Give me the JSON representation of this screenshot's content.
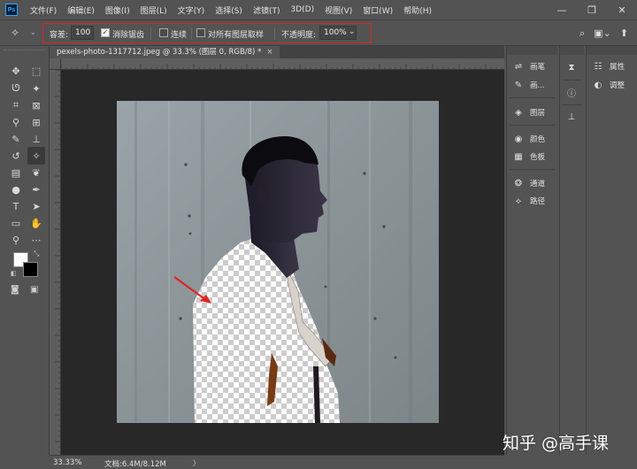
{
  "menubar": {
    "logo": "Ps",
    "items": [
      "文件(F)",
      "编辑(E)",
      "图像(I)",
      "图层(L)",
      "文字(Y)",
      "选择(S)",
      "滤镜(T)",
      "3D(D)",
      "视图(V)",
      "窗口(W)",
      "帮助(H)"
    ],
    "minimize": "—",
    "maximize": "❐",
    "close": "✕"
  },
  "options": {
    "tolerance_label": "容差:",
    "tolerance_value": "100",
    "antialias_label": "消除锯齿",
    "antialias_checked": true,
    "contiguous_label": "连续",
    "contiguous_checked": false,
    "sample_all_label": "对所有图层取样",
    "sample_all_checked": false,
    "opacity_label": "不透明度:",
    "opacity_value": "100%",
    "highlight_color": "#dd2222"
  },
  "document": {
    "tab_title": "pexels-photo-1317712.jpeg @ 33.3% (图层 0, RGB/8) *",
    "close_symbol": "×"
  },
  "status": {
    "zoom": "33.33%",
    "doc_info": "文档:6.4M/8.12M",
    "arrow": "〉"
  },
  "panels": {
    "col1": [
      {
        "icon": "brushes-icon",
        "glyph": "⇌",
        "label": "画笔"
      },
      {
        "icon": "brush-settings-icon",
        "glyph": "✎",
        "label": "画..."
      },
      {
        "icon": "layers-icon",
        "glyph": "◈",
        "label": "图层"
      },
      {
        "icon": "color-icon",
        "glyph": "◉",
        "label": "颜色"
      },
      {
        "icon": "swatches-icon",
        "glyph": "▦",
        "label": "色板"
      },
      {
        "icon": "channels-icon",
        "glyph": "❂",
        "label": "通道"
      },
      {
        "icon": "paths-icon",
        "glyph": "⟡",
        "label": "路径"
      }
    ],
    "col3": [
      {
        "icon": "properties-icon",
        "glyph": "☷",
        "label": "属性"
      },
      {
        "icon": "adjustments-icon",
        "glyph": "◐",
        "label": "调整"
      }
    ]
  },
  "colors": {
    "foreground": "#ffffff",
    "background": "#000000",
    "ui_bg": "#535353",
    "canvas_bg": "#282828"
  },
  "watermark": "知乎 @高手课"
}
